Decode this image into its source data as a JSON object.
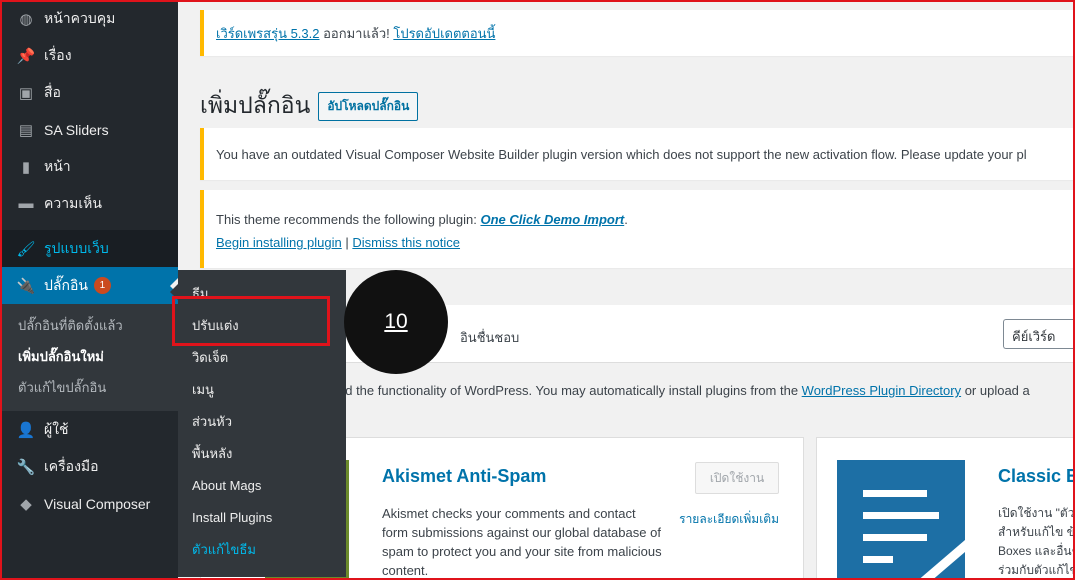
{
  "sidebar": {
    "items": [
      {
        "key": "dashboard",
        "label": "หน้าควบคุม",
        "icon": "dashboard-icon",
        "glyph": "◍"
      },
      {
        "key": "posts",
        "label": "เรื่อง",
        "icon": "pin-icon",
        "glyph": "📌"
      },
      {
        "key": "media",
        "label": "สื่อ",
        "icon": "media-icon",
        "glyph": "▣"
      },
      {
        "key": "sa-sliders",
        "label": "SA Sliders",
        "icon": "slides-icon",
        "glyph": "▤"
      },
      {
        "key": "pages",
        "label": "หน้า",
        "icon": "page-icon",
        "glyph": "▮"
      },
      {
        "key": "comments",
        "label": "ความเห็น",
        "icon": "comment-icon",
        "glyph": "▬"
      },
      {
        "key": "appearance",
        "label": "รูปแบบเว็บ",
        "icon": "brush-icon",
        "glyph": "🖌"
      },
      {
        "key": "plugins",
        "label": "ปลั๊กอิน",
        "icon": "plugin-icon",
        "glyph": "🔌",
        "badge": "1"
      },
      {
        "key": "users",
        "label": "ผู้ใช้",
        "icon": "user-icon",
        "glyph": "👤"
      },
      {
        "key": "tools",
        "label": "เครื่องมือ",
        "icon": "wrench-icon",
        "glyph": "🔧"
      },
      {
        "key": "visual-composer",
        "label": "Visual Composer",
        "icon": "vc-icon",
        "glyph": "◆"
      }
    ],
    "plugins_submenu": [
      "ปลั๊กอินที่ติดตั้งแล้ว",
      "เพิ่มปลั๊กอินใหม่",
      "ตัวแก้ไขปลั๊กอิน"
    ]
  },
  "flyout": {
    "items": [
      "ธีม",
      "ปรับแต่ง",
      "วิดเจ็ต",
      "เมนู",
      "ส่วนหัว",
      "พื้นหลัง",
      "About Mags",
      "Install Plugins",
      "ตัวแก้ไขธีม"
    ]
  },
  "callout": {
    "number": "10"
  },
  "update_notice": {
    "link": "เวิร์ดเพรสรุ่น 5.3.2",
    "text": " ออกมาแล้ว! ",
    "link2": "โปรดอัปเดตตอนนี้"
  },
  "heading": {
    "title": "เพิ่มปลั๊กอิน",
    "upload_button": "อัปโหลดปลั๊กอิน"
  },
  "vc_notice": {
    "text": "You have an outdated Visual Composer Website Builder plugin version which does not support the new activation flow. Please update your pl"
  },
  "theme_notice": {
    "text": "This theme recommends the following plugin: ",
    "plugin_link": "One Click Demo Import",
    "after": ".",
    "begin_link": "Begin installing plugin",
    "separator": " | ",
    "dismiss_link": "Dismiss this notice"
  },
  "filter_bar": {
    "tab_text": "อินชื่นชอบ",
    "keyword_label": "คีย์เวิร์ด"
  },
  "description": {
    "text": "nd the functionality of WordPress. You may automatically install plugins from the ",
    "link": "WordPress Plugin Directory",
    "after": " or upload a"
  },
  "cards": {
    "akismet": {
      "title": "Akismet Anti-Spam",
      "description": "Akismet checks your comments and contact form submissions against our global database of spam to protect you and your site from malicious content.",
      "activate": "เปิดใช้งาน",
      "more": "รายละเอียดเพิ่มเติม"
    },
    "classic": {
      "title": "Classic Ed",
      "description_lines": [
        "เปิดใช้งาน \"ตัว",
        "สำหรับแก้ไข ข้",
        "Boxes และอื่นๆ",
        "ร่วมกับตัวแก้ไข"
      ]
    }
  },
  "colors": {
    "sidebar_bg": "#23282d",
    "flyout_bg": "#32373c",
    "accent": "#0073aa",
    "highlight": "#e0131b",
    "notice_border": "#ffb900"
  }
}
